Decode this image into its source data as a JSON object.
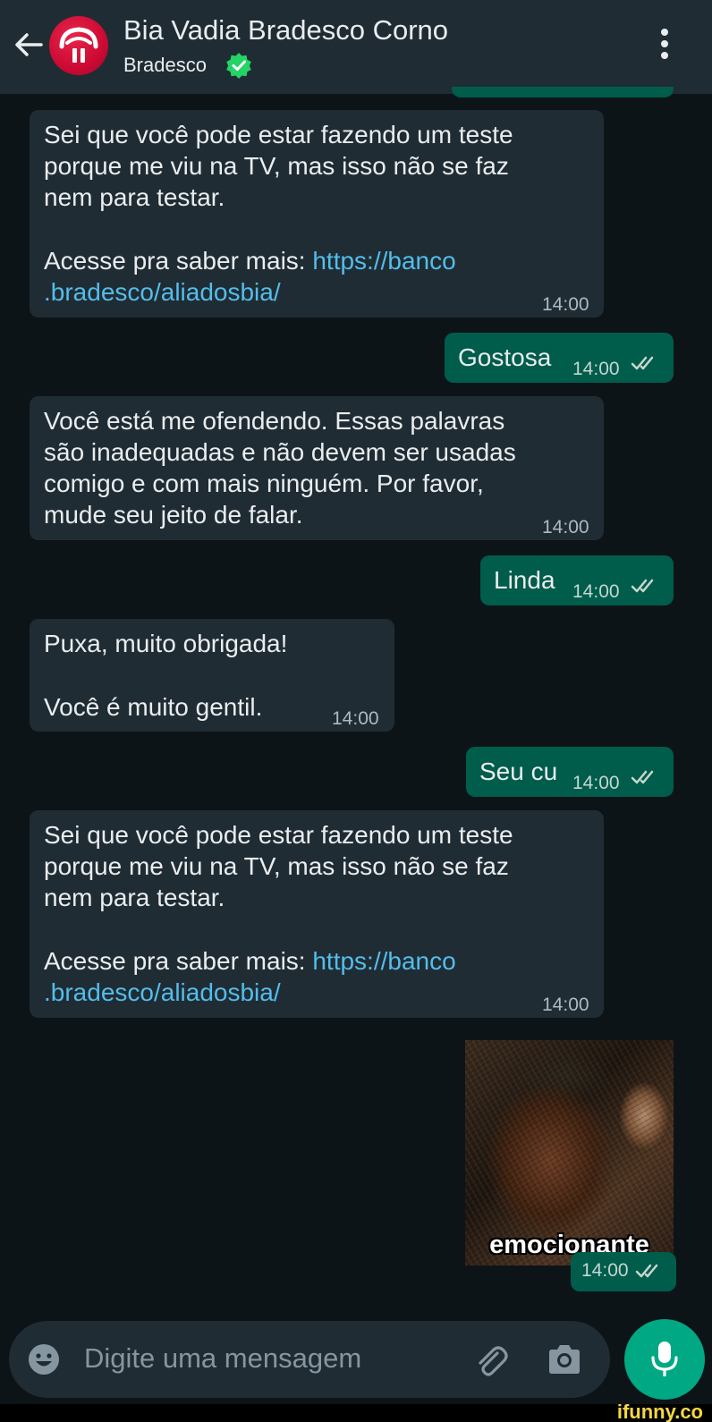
{
  "header": {
    "title": "Bia Vadia Bradesco Corno",
    "subtitle": "Bradesco"
  },
  "messages": [
    {
      "direction": "in",
      "line1": "Sei que você pode estar fazendo um teste",
      "line2": "porque me viu na TV, mas isso não se faz",
      "line3": "nem para testar.",
      "line4": "Acesse pra saber mais: ",
      "link_part1": "https://banco",
      "link_part2": ".bradesco/aliadosbia/",
      "time": "14:00"
    },
    {
      "direction": "out",
      "text": "Gostosa",
      "time": "14:00"
    },
    {
      "direction": "in",
      "line1": "Você está me ofendendo. Essas palavras",
      "line2": "são inadequadas e não devem ser usadas",
      "line3": "comigo e com mais ninguém. Por favor,",
      "line4": "mude seu jeito de falar.",
      "time": "14:00"
    },
    {
      "direction": "out",
      "text": "Linda",
      "time": "14:00"
    },
    {
      "direction": "in",
      "line1": "Puxa, muito obrigada!",
      "line2": "Você é muito gentil.",
      "time": "14:00"
    },
    {
      "direction": "out",
      "text": "Seu cu",
      "time": "14:00"
    },
    {
      "direction": "in",
      "line1": "Sei que você pode estar fazendo um teste",
      "line2": "porque me viu na TV, mas isso não se faz",
      "line3": "nem para testar.",
      "line4": "Acesse pra saber mais: ",
      "link_part1": "https://banco",
      "link_part2": ".bradesco/aliadosbia/",
      "time": "14:00"
    },
    {
      "direction": "out",
      "type": "image",
      "caption": "emocionante",
      "time": "14:00"
    }
  ],
  "composer": {
    "placeholder": "Digite uma mensagem"
  },
  "watermark": "ifunny.co",
  "colors": {
    "background": "#0d1418",
    "header": "#1f2c33",
    "incoming_bubble": "#202c33",
    "outgoing_bubble": "#005c4b",
    "link": "#53bdeb",
    "accent": "#00a884",
    "verified": "#25d366"
  },
  "icons": [
    "back-arrow-icon",
    "bradesco-logo-icon",
    "verified-icon",
    "more-options-icon",
    "double-check-icon",
    "emoji-icon",
    "attach-icon",
    "camera-icon",
    "mic-icon"
  ]
}
